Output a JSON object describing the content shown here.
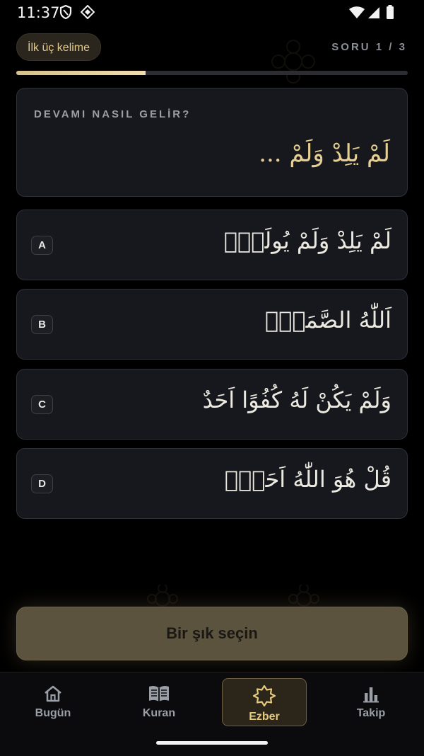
{
  "status_bar": {
    "time": "11:37"
  },
  "header": {
    "mode_chip": "İlk üç kelime",
    "question_counter": "SORU 1 / 3",
    "progress": 0.33
  },
  "question": {
    "label": "DEVAMI NASIL GELİR?",
    "arabic": "لَمْ يَلِدْ وَلَمْ ..."
  },
  "options": [
    {
      "letter": "A",
      "arabic": "لَمْ يَلِدْ وَلَمْ يُولَدْۙ"
    },
    {
      "letter": "B",
      "arabic": "اَللّٰهُ الصَّمَدُۚ"
    },
    {
      "letter": "C",
      "arabic": "وَلَمْ يَكُنْ لَهُ كُفُوًا اَحَدٌ"
    },
    {
      "letter": "D",
      "arabic": "قُلْ هُوَ اللّٰهُ اَحَدٌۚ"
    }
  ],
  "cta": {
    "label": "Bir şık seçin"
  },
  "nav": {
    "items": [
      {
        "label": "Bugün",
        "icon": "home-icon"
      },
      {
        "label": "Kuran",
        "icon": "book-icon"
      },
      {
        "label": "Ezber",
        "icon": "star-icon",
        "active": true
      },
      {
        "label": "Takip",
        "icon": "bar-chart-icon"
      }
    ]
  },
  "colors": {
    "accent": "#e6c97f",
    "background": "#000000",
    "card": "#16181d"
  }
}
